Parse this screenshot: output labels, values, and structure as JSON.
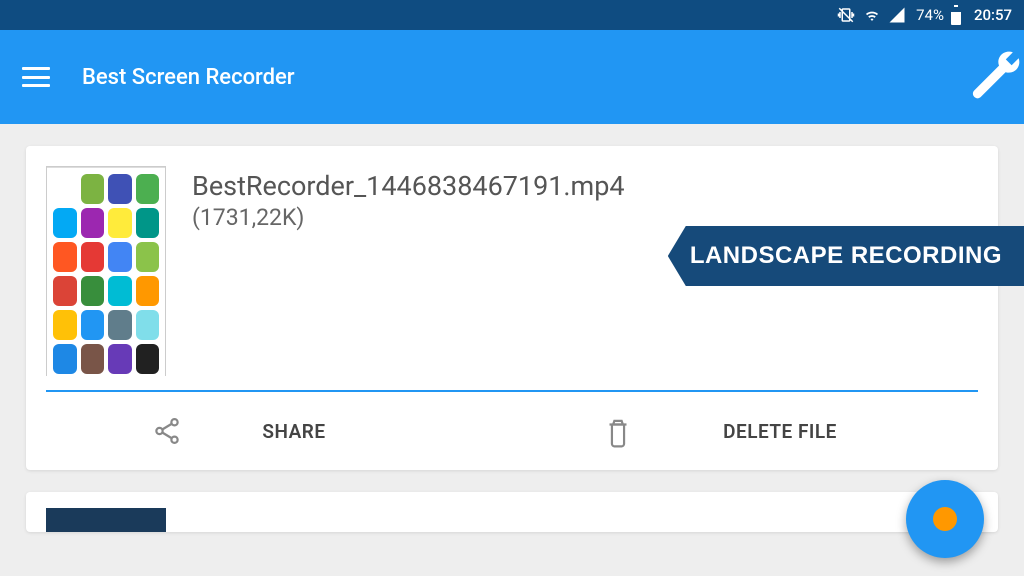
{
  "status": {
    "battery_pct": "74%",
    "time": "20:57"
  },
  "header": {
    "title": "Best Screen Recorder"
  },
  "file": {
    "name": "BestRecorder_1446838467191.mp4",
    "size": "(1731,22K)"
  },
  "actions": {
    "share": "SHARE",
    "delete": "DELETE FILE"
  },
  "badge": {
    "label": "LANDSCAPE RECORDING"
  },
  "thumb_colors": [
    "#ffffff",
    "#7cb342",
    "#3f51b5",
    "#4caf50",
    "#03a9f4",
    "#9c27b0",
    "#ffeb3b",
    "#009688",
    "#ff5722",
    "#e53935",
    "#4285f4",
    "#8bc34a",
    "#db4437",
    "#388e3c",
    "#00bcd4",
    "#ff9800",
    "#ffc107",
    "#2196f3",
    "#607d8b",
    "#80deea",
    "#1e88e5",
    "#795548",
    "#673ab7",
    "#212121"
  ]
}
